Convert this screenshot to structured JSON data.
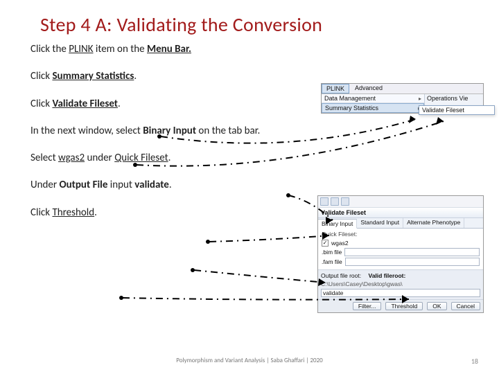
{
  "title": "Step 4 A: Validating the Conversion",
  "steps": {
    "s1a": "Click the ",
    "s1b": "PLINK",
    "s1c": " item on the ",
    "s1d": "Menu Bar.",
    "s2a": "Click ",
    "s2b": "Summary Statistics",
    "s2c": ".",
    "s3a": "Click ",
    "s3b": "Validate Fileset",
    "s3c": ".",
    "s4a": "In the next window, select ",
    "s4b": "Binary Input",
    "s4c": " on the tab bar.",
    "s5a": "Select ",
    "s5b": "wgas2",
    "s5c": " under ",
    "s5d": "Quick Fileset",
    "s5e": ".",
    "s6a": "Under ",
    "s6b": "Output File",
    "s6c": " input ",
    "s6d": "validate",
    "s6e": ".",
    "s7a": "Click ",
    "s7b": "Threshold",
    "s7c": "."
  },
  "menu": {
    "items": [
      "PLINK",
      "Advanced"
    ],
    "rows": [
      "Data Management",
      "Summary Statistics"
    ],
    "ops": "Operations Vie",
    "sub": "Validate Fileset"
  },
  "dialog": {
    "title": "Validate Fileset",
    "tabs": [
      "Binary Input",
      "Standard Input",
      "Alternate Phenotype"
    ],
    "qf_label": "Quick Fileset:",
    "qf_chk_label": "wgas2",
    "bim": ".bim file",
    "fam": ".fam file",
    "outlabel": "Output file root:",
    "outname": "Valid fileroot:",
    "outpath": "C:\\Users\\Casey\\Desktop\\gwas\\",
    "outval": "validate",
    "buttons": [
      "Filter...",
      "Threshold",
      "OK",
      "Cancel"
    ]
  },
  "footer": "Polymorphism and Variant Analysis | Saba Ghaffari | 2020",
  "pagenum": "18"
}
